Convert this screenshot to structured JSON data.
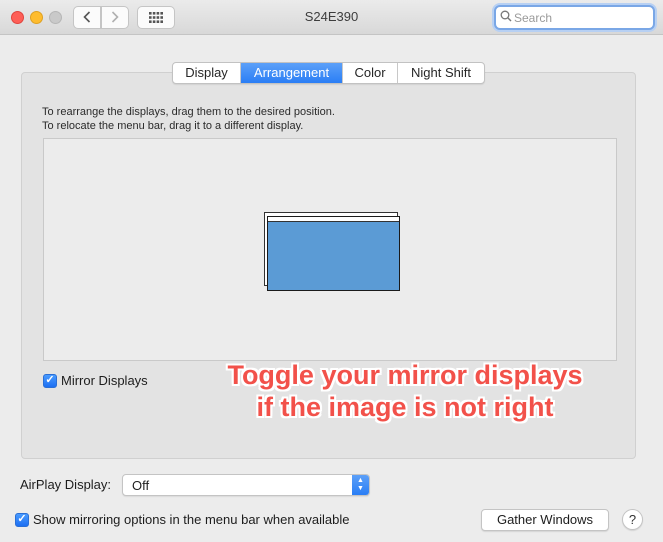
{
  "window": {
    "title": "S24E390"
  },
  "toolbar": {
    "back_icon": "chevron-left-icon",
    "forward_icon": "chevron-right-icon",
    "grid_icon": "grid-icon"
  },
  "search": {
    "placeholder": "Search",
    "value": ""
  },
  "tabs": [
    {
      "label": "Display",
      "active": false
    },
    {
      "label": "Arrangement",
      "active": true
    },
    {
      "label": "Color",
      "active": false
    },
    {
      "label": "Night Shift",
      "active": false
    }
  ],
  "arrangement": {
    "instruction_line1": "To rearrange the displays, drag them to the desired position.",
    "instruction_line2": "To relocate the menu bar, drag it to a different display.",
    "display_color": "#5b9bd5"
  },
  "mirror_displays": {
    "label": "Mirror Displays",
    "checked": true
  },
  "annotation": {
    "line1": "Toggle your mirror displays",
    "line2": "if the image is not right",
    "color": "#f2514a"
  },
  "airplay": {
    "label": "AirPlay Display:",
    "value": "Off"
  },
  "show_mirroring": {
    "label": "Show mirroring options in the menu bar when available",
    "checked": true
  },
  "buttons": {
    "gather_windows": "Gather Windows",
    "help": "?"
  },
  "colors": {
    "accent": "#2a7ef5",
    "window_bg": "#ececec"
  }
}
